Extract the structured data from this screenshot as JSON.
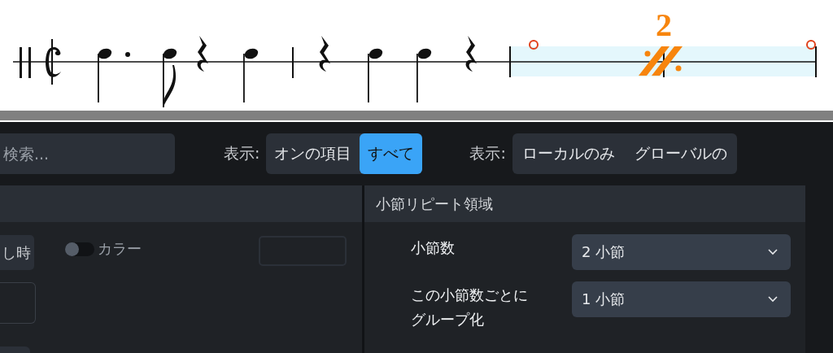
{
  "score": {
    "repeat_count": "2"
  },
  "toolbar": {
    "search": {
      "placeholder": "検索..."
    },
    "filters": [
      {
        "label": "表示:",
        "options": [
          {
            "label": "オンの項目",
            "selected": false
          },
          {
            "label": "すべて",
            "selected": true
          }
        ]
      },
      {
        "label": "表示:",
        "options": [
          {
            "label": "ローカルのみ",
            "selected": false
          },
          {
            "label": "グローバルの",
            "selected": false
          }
        ]
      }
    ]
  },
  "left_panel": {
    "button": "し時",
    "toggle": {
      "label": "カラー",
      "on": false
    }
  },
  "right_panel": {
    "title": "小節リピート領域",
    "rows": [
      {
        "label": "小節数",
        "value": "2 小節"
      },
      {
        "label": "この小節数ごとにグループ化",
        "value": "1 小節"
      }
    ]
  }
}
